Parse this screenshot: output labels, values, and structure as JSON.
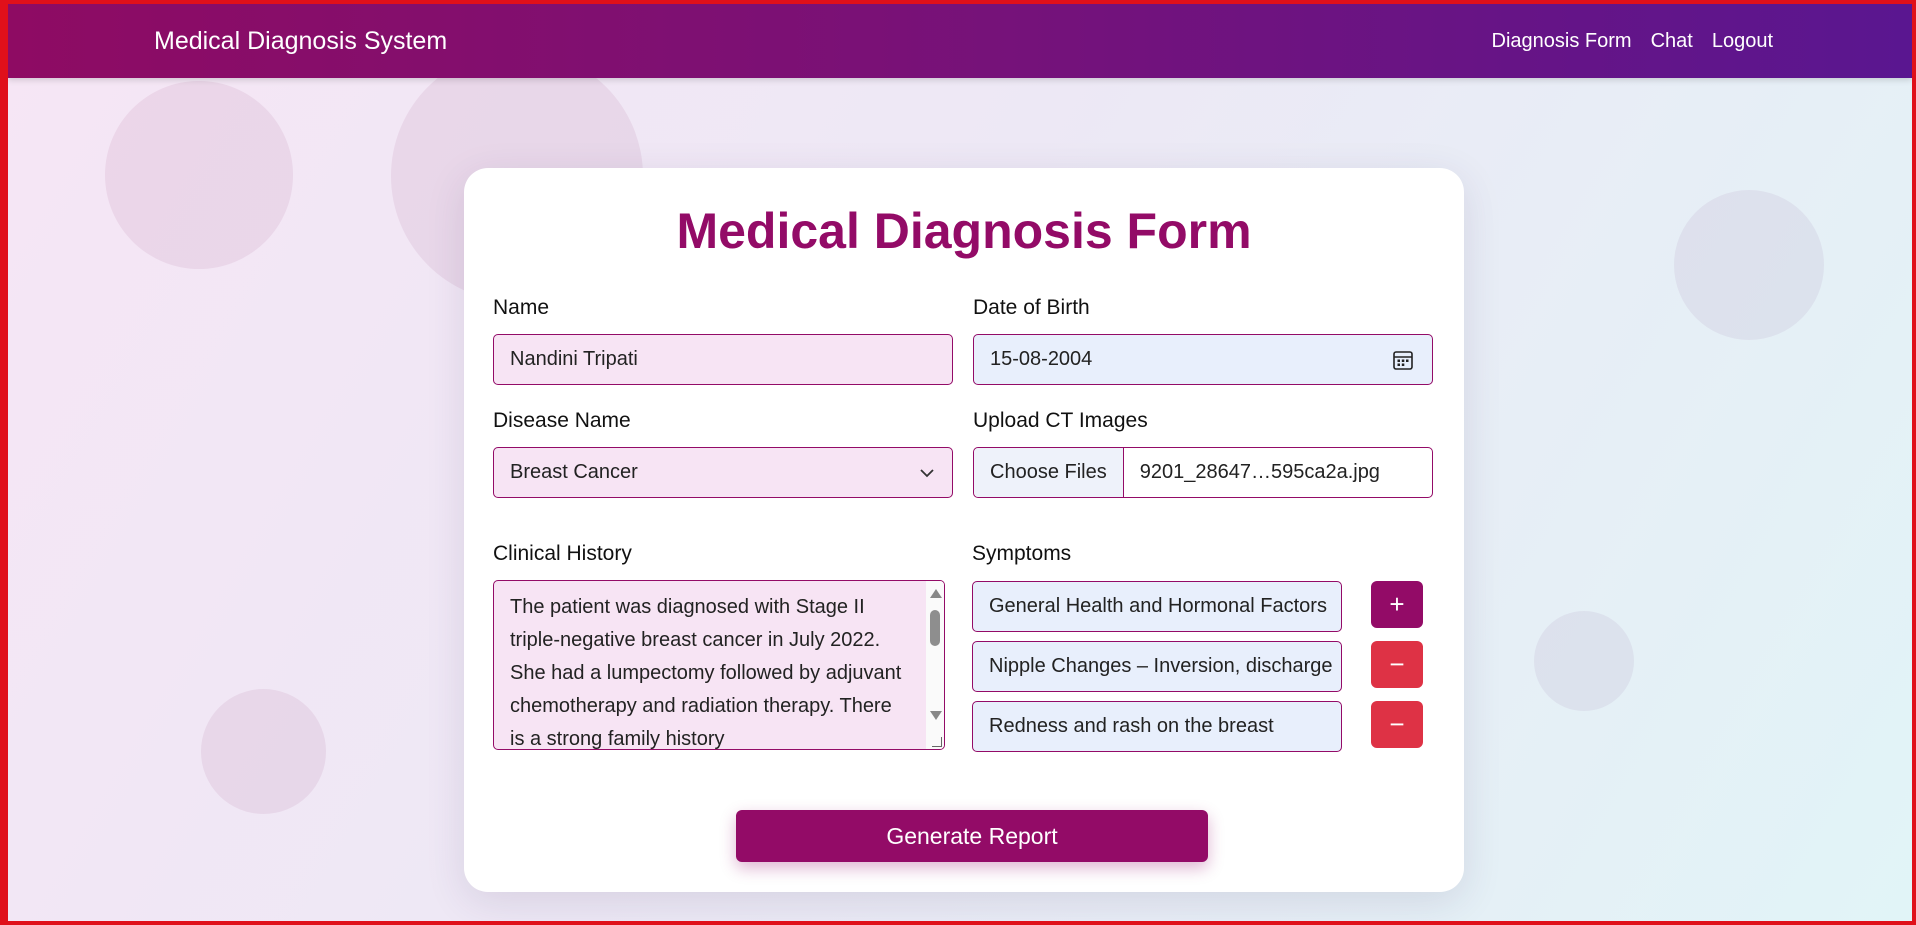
{
  "navbar": {
    "brand": "Medical Diagnosis System",
    "links": [
      "Diagnosis Form",
      "Chat",
      "Logout"
    ]
  },
  "form": {
    "title": "Medical Diagnosis Form",
    "name_label": "Name",
    "name_value": "Nandini Tripati",
    "dob_label": "Date of Birth",
    "dob_value": "15-08-2004",
    "disease_label": "Disease Name",
    "disease_value": "Breast Cancer",
    "upload_label": "Upload CT Images",
    "upload_button": "Choose Files",
    "upload_file": "9201_28647…595ca2a.jpg",
    "history_label": "Clinical History",
    "history_value": "The patient was diagnosed with Stage II triple-negative breast cancer in July 2022. She had a lumpectomy followed by adjuvant chemotherapy and radiation therapy. There is a strong family history",
    "symptoms_label": "Symptoms",
    "symptoms": [
      "General Health and Hormonal Factors",
      "Nipple Changes – Inversion, discharge",
      "Redness and rash on the breast"
    ],
    "add_symbol": "+",
    "remove_symbol": "−",
    "submit_label": "Generate Report"
  },
  "colors": {
    "primary": "#930b67",
    "danger": "#de3245",
    "nav_start": "#8e0b63",
    "nav_end": "#5a1690"
  }
}
